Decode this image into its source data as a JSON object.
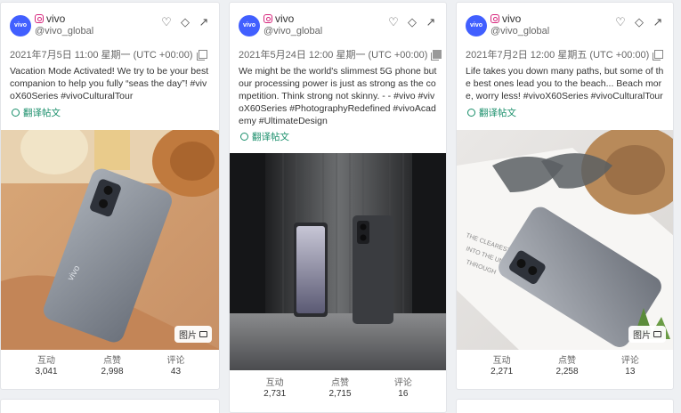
{
  "cards": [
    {
      "account": "vivo",
      "handle": "@vivo_global",
      "avatar_text": "vivo",
      "datetime": "2021年7月5日 11:00 星期一 (UTC +00:00)",
      "text": "Vacation Mode Activated! We try to be your best companion to help you fully “seas the day”! #vivoX60Series #vivoCulturalTour",
      "translate": "翻译帖文",
      "badge": "图片",
      "stats": [
        {
          "label": "互动",
          "value": "3,041"
        },
        {
          "label": "点赞",
          "value": "2,998"
        },
        {
          "label": "评论",
          "value": "43"
        }
      ]
    },
    {
      "account": "vivo",
      "handle": "@vivo_global",
      "avatar_text": "vivo",
      "datetime": "2021年5月24日 12:00 星期一 (UTC +00:00)",
      "text": "We might be the world's slimmest 5G phone but our processing power is just as strong as the competition. Think strong not skinny. - - #vivo #vivoX60Series #PhotographyRedefined #vivoAcademy #UltimateDesign",
      "translate": "翻译帖文",
      "stats": [
        {
          "label": "互动",
          "value": "2,731"
        },
        {
          "label": "点赞",
          "value": "2,715"
        },
        {
          "label": "评论",
          "value": "16"
        }
      ]
    },
    {
      "account": "vivo",
      "handle": "@vivo_global",
      "avatar_text": "vivo",
      "datetime": "2021年7月2日 12:00 星期五 (UTC +00:00)",
      "text": "Life takes you down many paths, but some of the best ones lead you to the beach... Beach more, worry less! #vivoX60Series #vivoCulturalTour",
      "translate": "翻译帖文",
      "badge": "图片",
      "stats": [
        {
          "label": "互动",
          "value": "2,271"
        },
        {
          "label": "点赞",
          "value": "2,258"
        },
        {
          "label": "评论",
          "value": "13"
        }
      ]
    }
  ],
  "icons": {
    "heart": "heart-icon",
    "tag": "tag-icon",
    "share": "share-icon",
    "copy": "copy-icon",
    "globe": "globe-icon",
    "gallery": "gallery-icon"
  },
  "colors": {
    "brand": "#415fff",
    "instagram": "#d6247b",
    "translate": "#1a8f6b"
  }
}
